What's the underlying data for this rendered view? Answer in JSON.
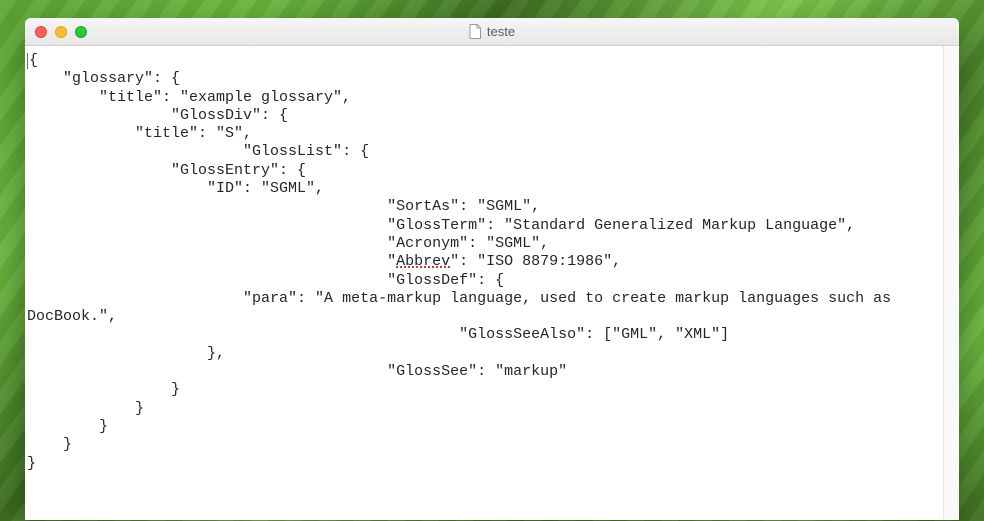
{
  "window": {
    "title": "teste"
  },
  "content": {
    "lines": [
      "{",
      "    \"glossary\": {",
      "        \"title\": \"example glossary\",",
      "                \"GlossDiv\": {",
      "            \"title\": \"S\",",
      "                        \"GlossList\": {",
      "                \"GlossEntry\": {",
      "                    \"ID\": \"SGML\",",
      "                                        \"SortAs\": \"SGML\",",
      "                                        \"GlossTerm\": \"Standard Generalized Markup Language\",",
      "                                        \"Acronym\": \"SGML\",",
      "                                        \"Abbrev\": \"ISO 8879:1986\",",
      "                                        \"GlossDef\": {",
      "                        \"para\": \"A meta-markup language, used to create markup languages such as DocBook.\",",
      "                                                \"GlossSeeAlso\": [\"GML\", \"XML\"]",
      "                    },",
      "                                        \"GlossSee\": \"markup\"",
      "                }",
      "            }",
      "        }",
      "    }",
      "}"
    ],
    "spell_error_token": "Abbrev"
  }
}
